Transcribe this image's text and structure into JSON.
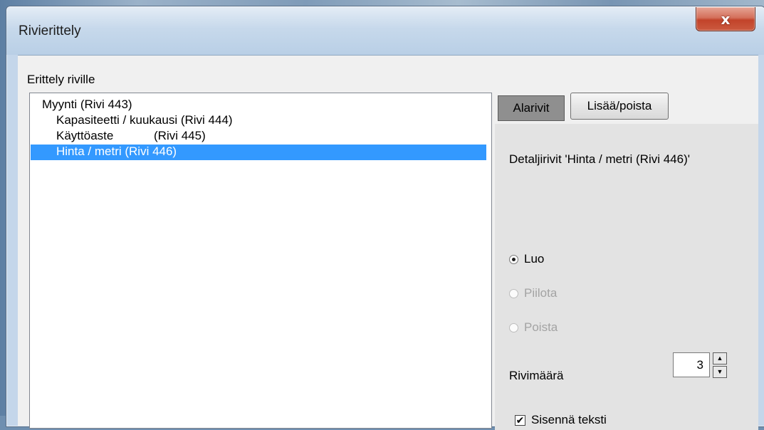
{
  "window": {
    "title": "Rivierittely",
    "close_label": "x"
  },
  "group": {
    "label": "Erittely riville"
  },
  "list": {
    "items": [
      {
        "label": "Myynti (Rivi 443)"
      },
      {
        "label": "Kapasiteetti / kuukausi (Rivi 444)"
      },
      {
        "label": "Käyttöaste            (Rivi 445)"
      },
      {
        "label": "Hinta / metri (Rivi 446)",
        "selected": true
      }
    ]
  },
  "tabs": {
    "active": "Alarivit",
    "inactive": "Lisää/poista"
  },
  "panel": {
    "detail_label": "Detaljirivit 'Hinta / metri (Rivi 446)'",
    "radio_options": [
      {
        "label": "Luo",
        "checked": true,
        "enabled": true
      },
      {
        "label": "Piilota",
        "checked": false,
        "enabled": false
      },
      {
        "label": "Poista",
        "checked": false,
        "enabled": false
      }
    ],
    "row_count_label": "Rivimäärä",
    "row_count_value": "3",
    "indent_label": "Sisennä teksti",
    "indent_checked": true
  }
}
